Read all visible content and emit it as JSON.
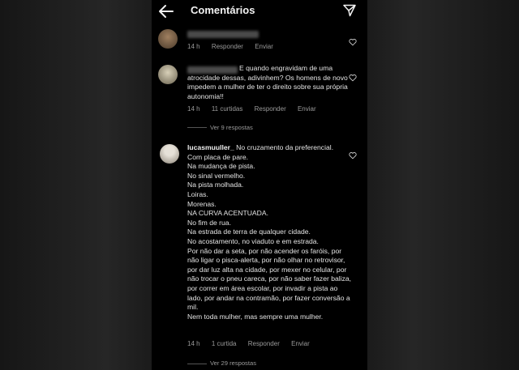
{
  "header": {
    "title": "Comentários",
    "back_icon": "arrow-left-icon",
    "send_icon": "paper-plane-icon"
  },
  "comments": [
    {
      "time": "14 h",
      "reply": "Responder",
      "send": "Enviar",
      "text": ""
    },
    {
      "text": "E quando engravidam de uma atrocidade dessas, adivinhem? Os homens de novo impedem a mulher de ter o direito sobre sua própria autonomia!!",
      "time": "14 h",
      "likes": "11 curtidas",
      "reply": "Responder",
      "send": "Enviar",
      "view_replies": "Ver 9 respostas"
    },
    {
      "username": "lucasmuuller_",
      "text": " No cruzamento da preferencial.\nCom placa de pare.\nNa mudança de pista.\nNo sinal vermelho.\nNa pista molhada.\nLoiras.\nMorenas.\nNA CURVA ACENTUADA.\nNo fim de rua.\nNa estrada de terra de qualquer cidade.\nNo acostamento, no viaduto e em estrada.\nPor não dar a seta, por não acender os faróis, por não ligar o pisca-alerta, por não olhar no retrovisor, por dar luz alta na cidade, por mexer no celular, por não trocar o pneu careca, por não saber fazer baliza, por correr em área escolar, por invadir a pista ao lado, por andar na contramão, por fazer conversão a mil.\nNem toda mulher, mas sempre uma mulher.",
      "time": "14 h",
      "likes": "1 curtida",
      "reply": "Responder",
      "send": "Enviar",
      "view_replies": "Ver 29 respostas"
    }
  ],
  "colors": {
    "background": "#000000",
    "text": "#e4e4e4",
    "muted": "#9a9a9a"
  }
}
